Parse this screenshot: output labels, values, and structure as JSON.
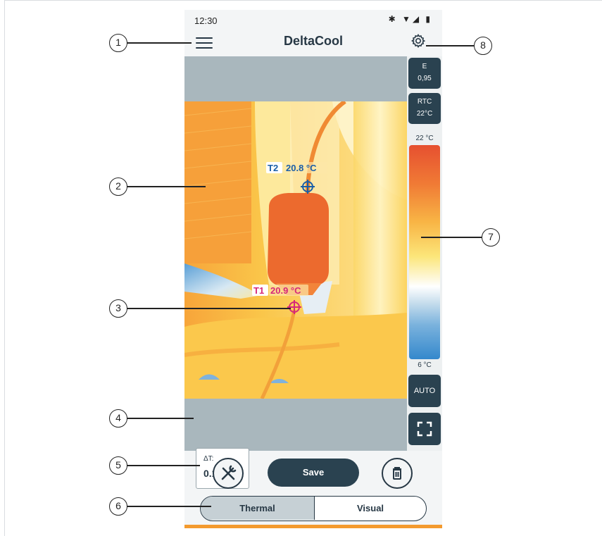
{
  "status_bar": {
    "time": "12:30",
    "icons": "✱ ▼◢ ▮"
  },
  "app_bar": {
    "title": "DeltaCool"
  },
  "measurement": {
    "emissivity_label": "E",
    "emissivity_value": "0,95",
    "rtc_label": "RTC",
    "rtc_value": "22°C"
  },
  "scale": {
    "max": "22 °C",
    "min": "6 °C",
    "auto_label": "AUTO"
  },
  "markers": [
    {
      "id": "T2",
      "temp": "20.8 °C",
      "color": "#1b5fa8"
    },
    {
      "id": "T1",
      "temp": "20.9 °C",
      "color": "#d6287a"
    }
  ],
  "delta": {
    "label": "ΔT:",
    "value": "0.1 K"
  },
  "actions": {
    "save": "Save"
  },
  "mode": {
    "thermal": "Thermal",
    "visual": "Visual",
    "selected": "Thermal"
  },
  "callouts": [
    "1",
    "2",
    "3",
    "4",
    "5",
    "6",
    "7",
    "8"
  ],
  "colors": {
    "accent": "#2a4250",
    "highlight": "#f39a2e"
  }
}
